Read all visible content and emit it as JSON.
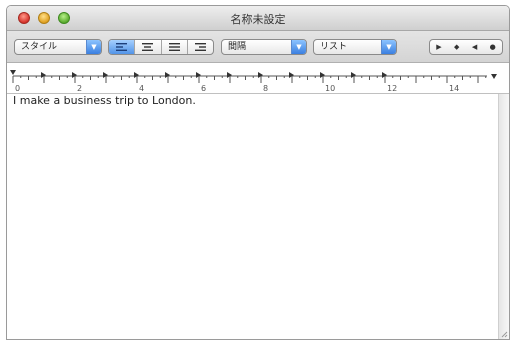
{
  "window": {
    "title": "名称未設定"
  },
  "toolbar": {
    "style_popup": {
      "label": "スタイル",
      "icon": "chevron-down-icon"
    },
    "alignment": {
      "selected": "left",
      "options": [
        "left",
        "center",
        "justify",
        "right"
      ]
    },
    "spacing_popup": {
      "label": "間隔",
      "icon": "chevron-down-icon"
    },
    "list_popup": {
      "label": "リスト",
      "icon": "chevron-down-icon"
    },
    "tab_stops": {
      "icons": [
        "right-triangle-icon",
        "diamond-icon",
        "left-triangle-icon",
        "circle-icon"
      ]
    }
  },
  "ruler": {
    "labels": [
      "0",
      "2",
      "4",
      "6",
      "8",
      "10",
      "12",
      "14"
    ]
  },
  "document": {
    "text": "I make a business trip to London."
  },
  "colors": {
    "accent": "#3a7fe0",
    "close": "#d6322a",
    "minimize": "#e0a020",
    "zoom": "#5aab2e"
  }
}
